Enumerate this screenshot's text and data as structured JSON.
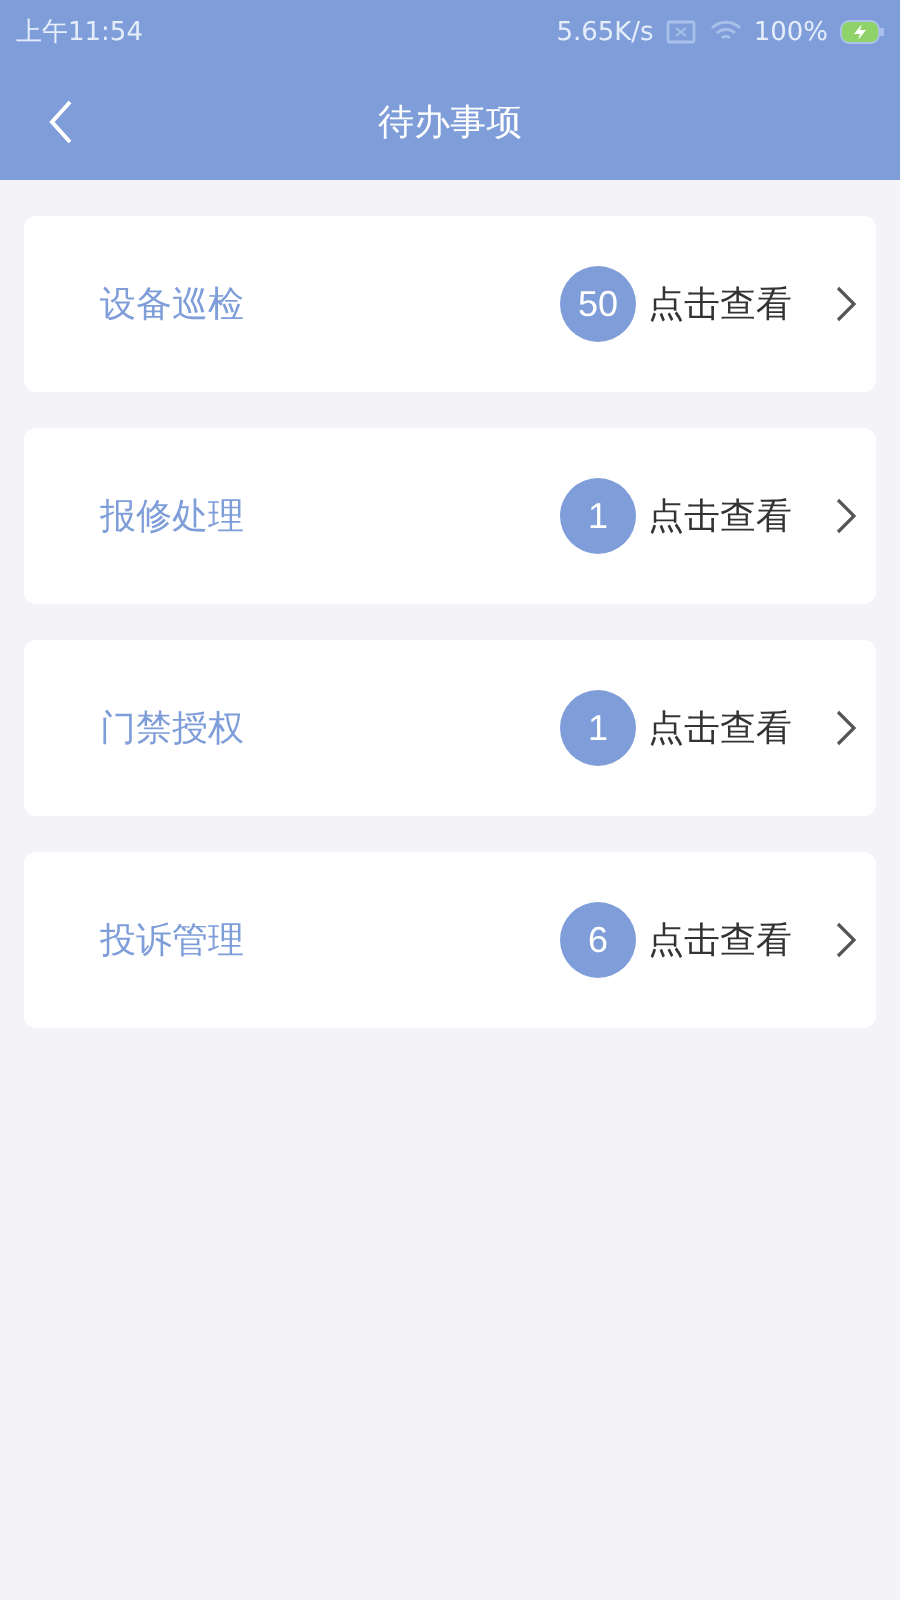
{
  "status_bar": {
    "time": "上午11:54",
    "speed": "5.65K/s",
    "battery": "100%"
  },
  "header": {
    "title": "待办事项"
  },
  "items": [
    {
      "label": "设备巡检",
      "count": "50",
      "action": "点击查看"
    },
    {
      "label": "报修处理",
      "count": "1",
      "action": "点击查看"
    },
    {
      "label": "门禁授权",
      "count": "1",
      "action": "点击查看"
    },
    {
      "label": "投诉管理",
      "count": "6",
      "action": "点击查看"
    }
  ]
}
